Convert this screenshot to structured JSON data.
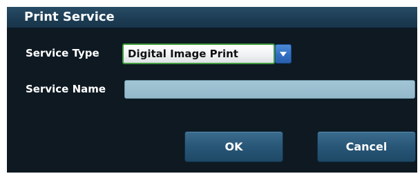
{
  "dialog": {
    "title": "Print Service",
    "service_type_label": "Service Type",
    "service_type_value": "Digital Image Print",
    "service_name_label": "Service Name",
    "service_name_value": "",
    "ok_label": "OK",
    "cancel_label": "Cancel"
  },
  "colors": {
    "dialog_background": "#0e1922",
    "titlebar": "#1d3d55",
    "select_border": "#3f9a3a",
    "dropdown_arrow": "#2f6cc0",
    "input_fill": "#9bbfd0",
    "button": "#2a5879",
    "text": "#ffffff"
  },
  "icons": {
    "dropdown": "chevron-down-icon"
  }
}
